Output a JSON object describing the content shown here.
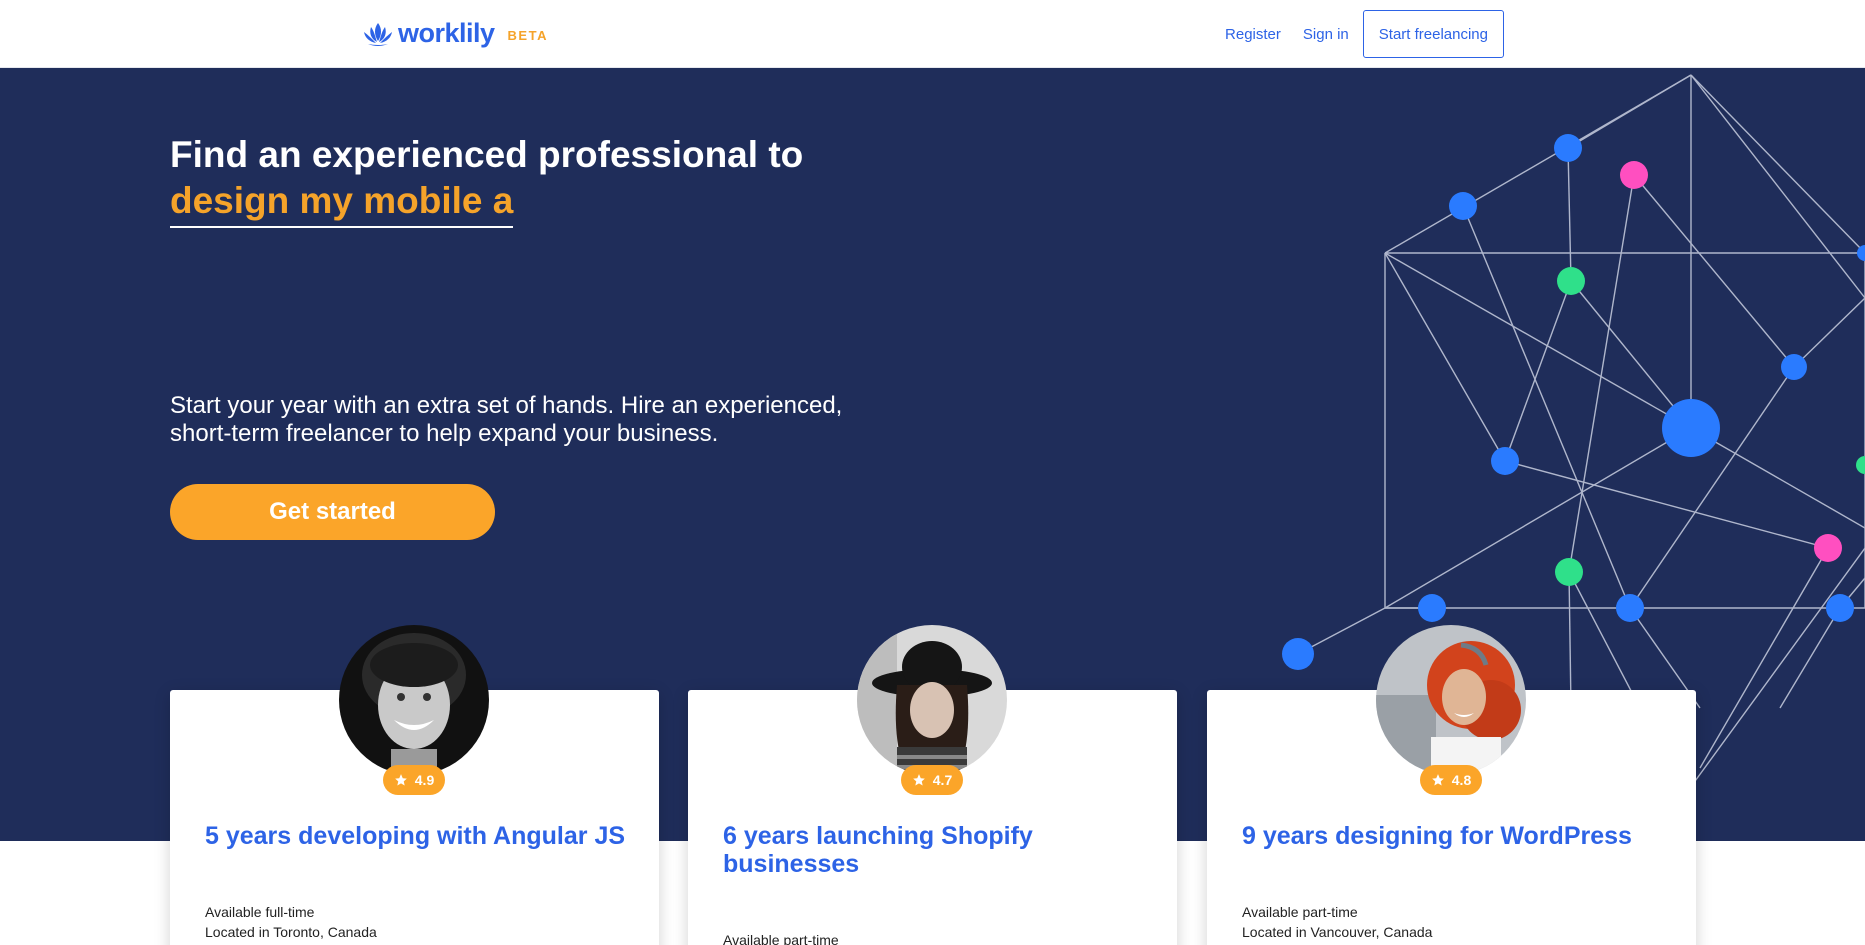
{
  "brand": {
    "name": "worklily",
    "badge": "BETA"
  },
  "nav": {
    "register": "Register",
    "signin": "Sign in",
    "start": "Start freelancing"
  },
  "hero": {
    "headline": "Find an experienced professional to",
    "typed": "design my mobile a",
    "subtext_line1": "Start your year with an extra set of hands. Hire an experienced,",
    "subtext_line2": "short-term freelancer to help expand your business.",
    "cta": "Get started"
  },
  "cards": [
    {
      "rating": "4.9",
      "title": "5 years developing with Angular JS",
      "availability": "Available full-time",
      "location": "Located in Toronto, Canada"
    },
    {
      "rating": "4.7",
      "title": "6 years launching Shopify businesses",
      "availability": "Available part-time",
      "location": ""
    },
    {
      "rating": "4.8",
      "title": "9 years designing for WordPress",
      "availability": "Available part-time",
      "location": "Located in Vancouver, Canada"
    }
  ],
  "colors": {
    "navy": "#1f2d5a",
    "brand_blue": "#2d63e6",
    "accent_orange": "#fba529",
    "node_green": "#2fe08a",
    "node_pink": "#ff4fc0",
    "node_blue": "#2a7bff"
  },
  "icons": {
    "logo": "lotus-icon",
    "rating": "star-icon"
  }
}
